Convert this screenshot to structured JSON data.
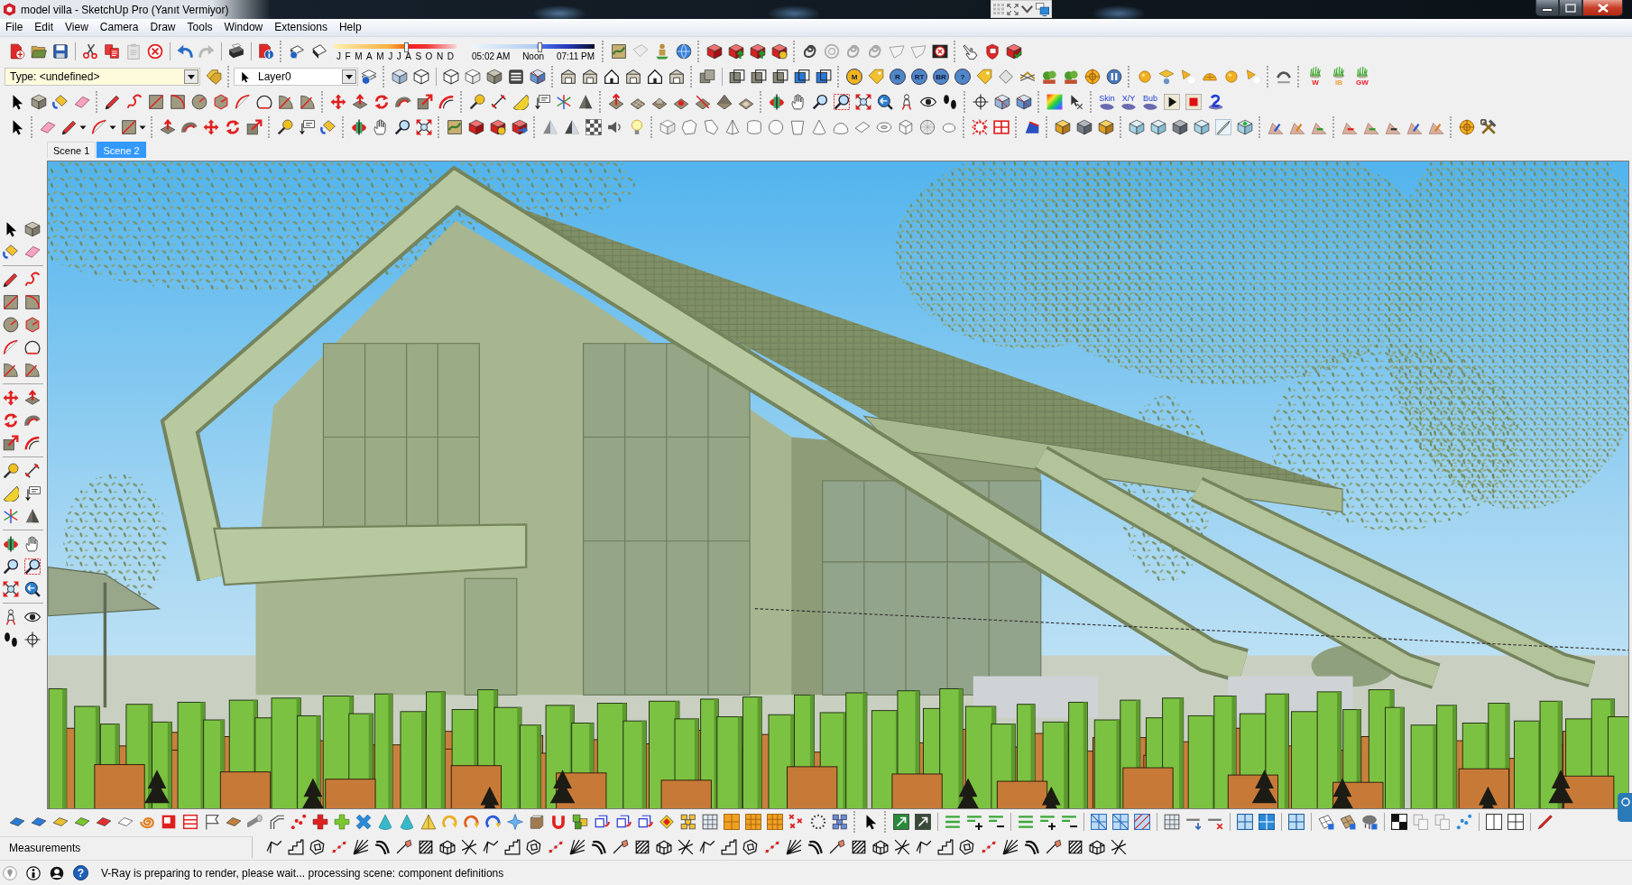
{
  "window": {
    "title": "model villa - SketchUp Pro (Yanıt Vermiyor)"
  },
  "menu": [
    "File",
    "Edit",
    "View",
    "Camera",
    "Draw",
    "Tools",
    "Window",
    "Extensions",
    "Help"
  ],
  "shadow_settings": {
    "date_slider": {
      "level": 0.59
    },
    "months": [
      "J",
      "F",
      "M",
      "A",
      "M",
      "J",
      "J",
      "A",
      "S",
      "O",
      "N",
      "D"
    ],
    "time_slider": {
      "level": 0.55
    },
    "times": [
      "05:02 AM",
      "Noon",
      "07:11 PM"
    ]
  },
  "entity_type": {
    "value": "Type: <undefined>"
  },
  "layer": {
    "value": "Layer0"
  },
  "render_buttons": [
    {
      "label": "M",
      "color": "#f0b41e"
    },
    {
      "label": "R",
      "color": "#4f86c8"
    },
    {
      "label": "RT",
      "color": "#4f86c8"
    },
    {
      "label": "BR",
      "color": "#4f86c8"
    },
    {
      "label": "?",
      "color": "#4f86c8"
    }
  ],
  "skin_tools": [
    "Skin",
    "X/Y",
    "Bub"
  ],
  "grass_tools": [
    {
      "label": "W",
      "color": "#f01818"
    },
    {
      "label": "IB",
      "color": "#f0a040"
    },
    {
      "label": "GW",
      "color": "#f01830"
    }
  ],
  "scenes": [
    {
      "label": "Scene 1",
      "selected": false
    },
    {
      "label": "Scene 2",
      "selected": true
    }
  ],
  "measurements": {
    "label": "Measurements"
  },
  "status_bar": {
    "help": "?",
    "message": "V-Ray is preparing to render, please wait... processing scene: component definitions"
  }
}
